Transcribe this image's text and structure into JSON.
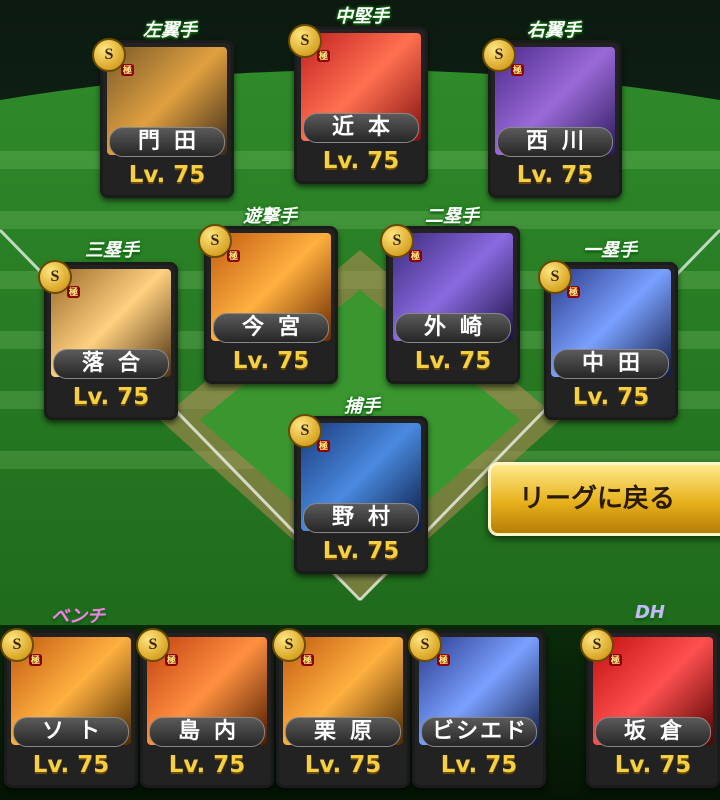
{
  "colors": {
    "level": "#f6d040",
    "button": "#e7b11c"
  },
  "positions": {
    "lf": "左翼手",
    "cf": "中堅手",
    "rf": "右翼手",
    "ss": "遊撃手",
    "b2": "二塁手",
    "b3": "三塁手",
    "b1": "一塁手",
    "c": "捕手",
    "bench": "ベンチ",
    "dh": "DH"
  },
  "players": {
    "lf": {
      "name": "門田",
      "level": "Lv. 75"
    },
    "cf": {
      "name": "近本",
      "level": "Lv. 75"
    },
    "rf": {
      "name": "西川",
      "level": "Lv. 75"
    },
    "ss": {
      "name": "今宮",
      "level": "Lv. 75"
    },
    "b2": {
      "name": "外崎",
      "level": "Lv. 75"
    },
    "b3": {
      "name": "落合",
      "level": "Lv. 75"
    },
    "b1": {
      "name": "中田",
      "level": "Lv. 75"
    },
    "c": {
      "name": "野村",
      "level": "Lv. 75"
    },
    "bench1": {
      "name": "ソト",
      "level": "Lv. 75"
    },
    "bench2": {
      "name": "島内",
      "level": "Lv. 75"
    },
    "bench3": {
      "name": "栗原",
      "level": "Lv. 75"
    },
    "bench4": {
      "name": "ビシエド",
      "level": "Lv. 75"
    },
    "dh": {
      "name": "坂倉",
      "level": "Lv. 75"
    }
  },
  "badge": {
    "rank": "S",
    "tier": "極"
  },
  "league_button": "リーグに戻る"
}
